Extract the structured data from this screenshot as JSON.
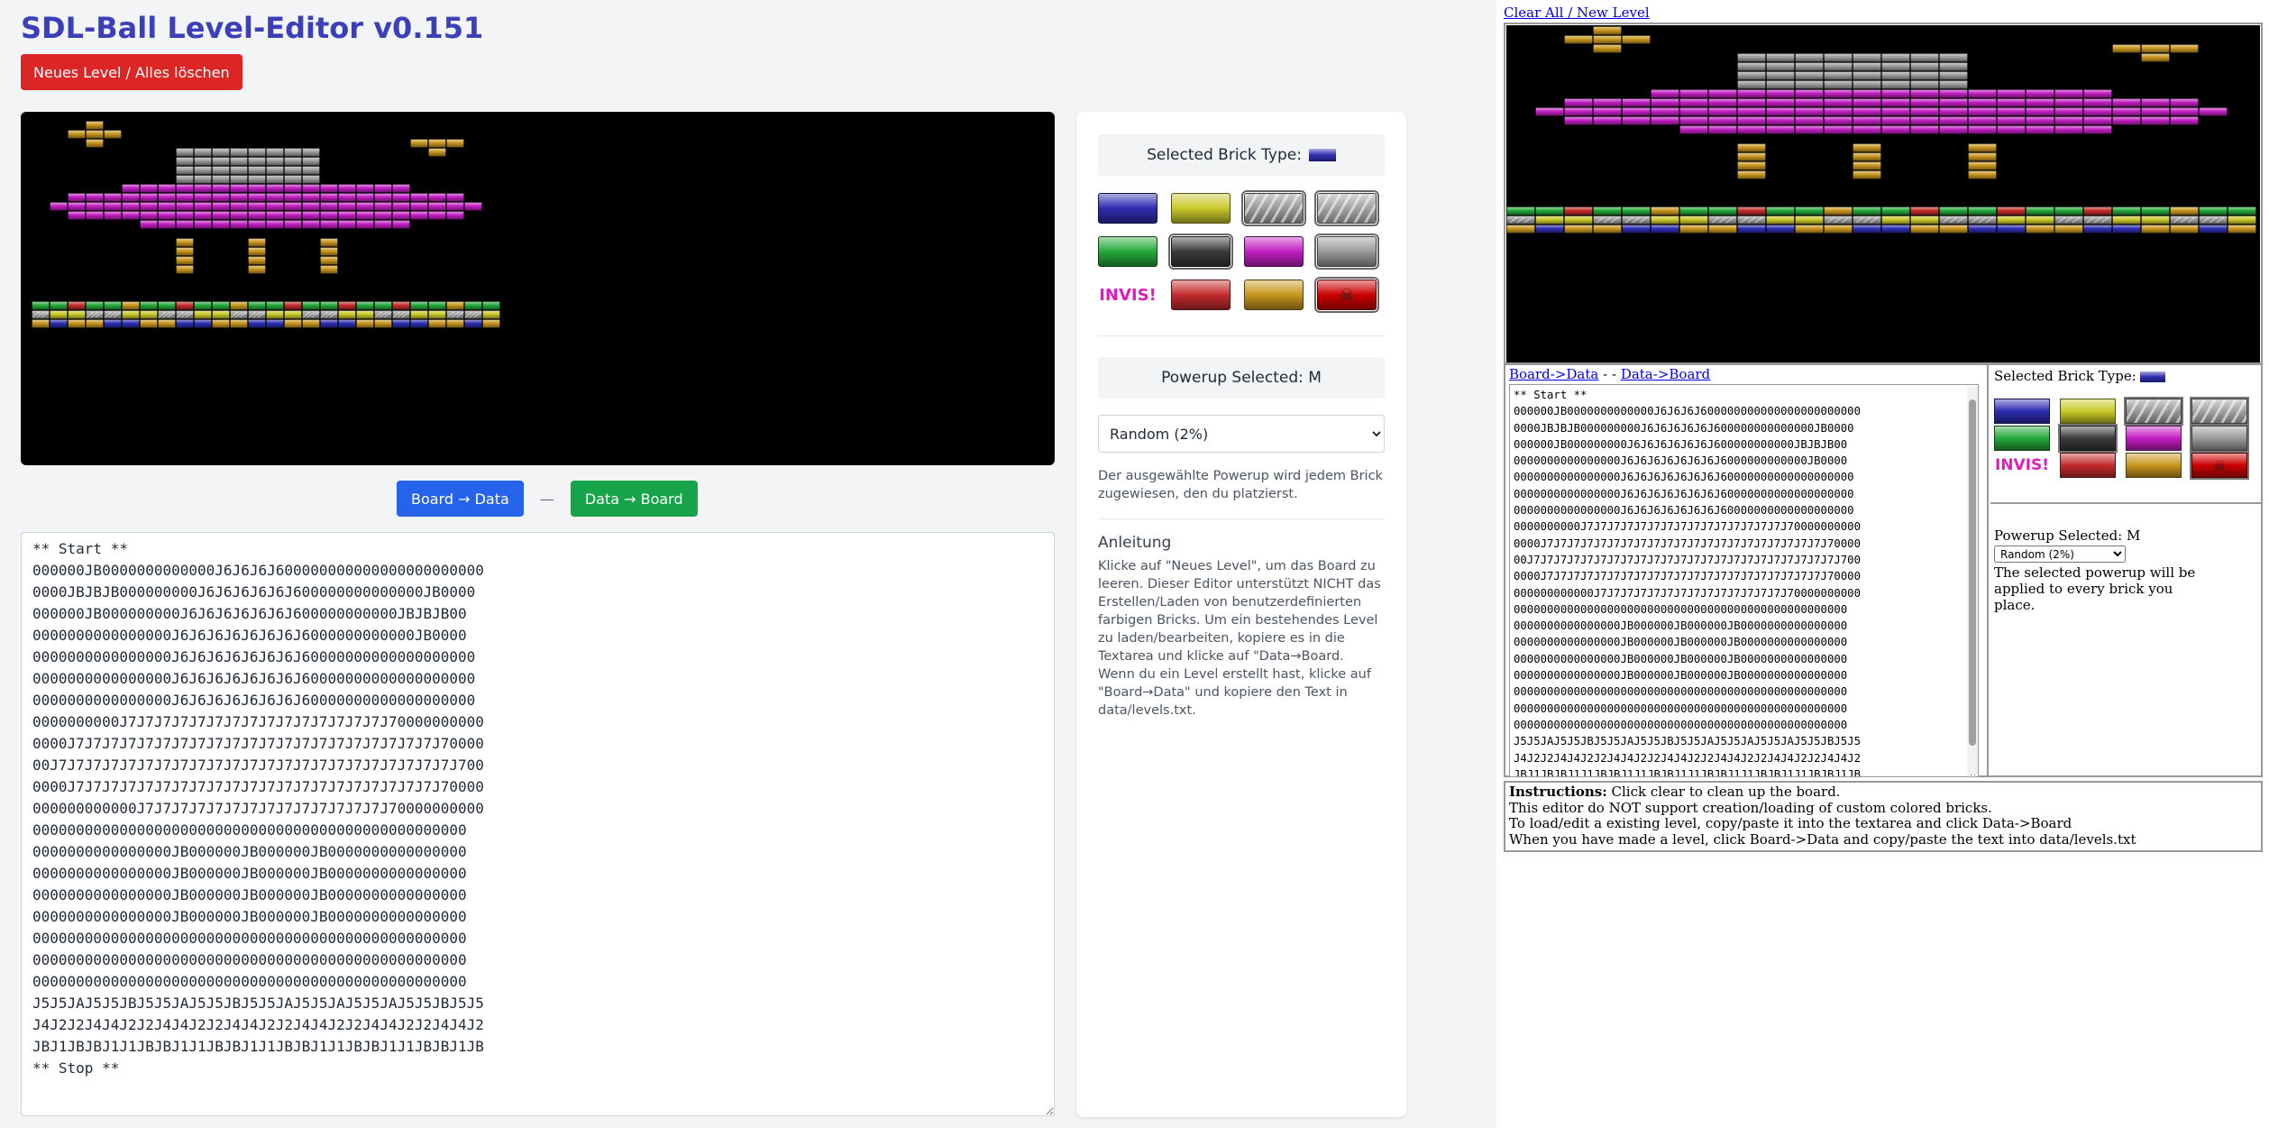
{
  "app": {
    "title": "SDL-Ball Level-Editor v0.151"
  },
  "actions": {
    "new_level": "Neues Level / Alles löschen",
    "board_to_data": "Board → Data",
    "separator": "—",
    "data_to_board": "Data → Board"
  },
  "side": {
    "selected_brick_label": "Selected Brick Type:",
    "selected_brick_color": "#2d2db0",
    "brick_palette": [
      {
        "id": "blue",
        "color": "#2d2db0"
      },
      {
        "id": "yellow",
        "color": "#c9c92a"
      },
      {
        "id": "glass",
        "color": "#8a8a8a"
      },
      {
        "id": "cement",
        "color": "#9a9a9a"
      },
      {
        "id": "green",
        "color": "#25a83a"
      },
      {
        "id": "black",
        "color": "#3a3a3a"
      },
      {
        "id": "purple",
        "color": "#c21ec2"
      },
      {
        "id": "grey",
        "color": "#9a9a9a"
      },
      {
        "id": "invisible",
        "label": "INVIS!"
      },
      {
        "id": "red",
        "color": "#c42b2b"
      },
      {
        "id": "gold",
        "color": "#c8961e"
      },
      {
        "id": "explosive",
        "color": "#cc0000"
      }
    ],
    "powerup_selected_label": "Powerup Selected: M",
    "powerup_option": "Random (2%)",
    "powerup_note": "Der ausgewählte Powerup wird jedem Brick zugewiesen, den du platzierst.",
    "instructions_title": "Anleitung",
    "instructions_body": "Klicke auf \"Neues Level\", um das Board zu leeren. Dieser Editor unterstützt NICHT das Erstellen/Laden von benutzerdefinierten farbigen Bricks. Um ein bestehendes Level zu laden/bearbeiten, kopiere es in die Textarea und klicke auf \"Data→Board. Wenn du ein Level erstellt hast, klicke auf \"Board→Data\" und kopiere den Text in data/levels.txt."
  },
  "level_text": "** Start **\n000000JB0000000000000J6J6J6J600000000000000000000000\n0000JBJBJB000000000J6J6J6J6J6J600000000000000JB0000\n000000JB000000000J6J6J6J6J6J6J600000000000JBJBJB00\n0000000000000000J6J6J6J6J6J6J6J6000000000000JB0000\n0000000000000000J6J6J6J6J6J6J6J60000000000000000000\n0000000000000000J6J6J6J6J6J6J6J60000000000000000000\n0000000000000000J6J6J6J6J6J6J6J60000000000000000000\n0000000000J7J7J7J7J7J7J7J7J7J7J7J7J7J7J7J70000000000\n0000J7J7J7J7J7J7J7J7J7J7J7J7J7J7J7J7J7J7J7J7J7J70000\n00J7J7J7J7J7J7J7J7J7J7J7J7J7J7J7J7J7J7J7J7J7J7J7J700\n0000J7J7J7J7J7J7J7J7J7J7J7J7J7J7J7J7J7J7J7J7J7J70000\n000000000000J7J7J7J7J7J7J7J7J7J7J7J7J7J7J70000000000\n00000000000000000000000000000000000000000000000000\n0000000000000000JB000000JB000000JB0000000000000000\n0000000000000000JB000000JB000000JB0000000000000000\n0000000000000000JB000000JB000000JB0000000000000000\n0000000000000000JB000000JB000000JB0000000000000000\n00000000000000000000000000000000000000000000000000\n00000000000000000000000000000000000000000000000000\n00000000000000000000000000000000000000000000000000\nJ5J5JAJ5J5JBJ5J5JAJ5J5JBJ5J5JAJ5J5JAJ5J5JAJ5J5JBJ5J5\nJ4J2J2J4J4J2J2J4J4J2J2J4J4J2J2J4J4J2J2J4J4J2J2J4J4J2\nJBJ1JBJBJ1J1JBJBJ1J1JBJBJ1J1JBJBJ1J1JBJBJ1J1JBJBJ1JB\n** Stop **",
  "legacy": {
    "clear_link": "Clear All / New Level",
    "board_to_data_link": "Board->Data",
    "link_sep": " - - ",
    "data_to_board_link": "Data->Board",
    "selected_brick_label": "Selected Brick Type:",
    "powerup_selected_label": "Powerup Selected: M",
    "powerup_option": "Random (2%)",
    "powerup_note": "The selected powerup will be applied to every brick you place.",
    "instructions_title": "Instructions:",
    "instructions_1": " Click clear to clean up the board.",
    "instructions_2": "This editor do NOT support creation/loading of custom colored bricks.",
    "instructions_3": "To load/edit a existing level, copy/paste it into the textarea and click Data->Board",
    "instructions_4": "When you have made a level, click Board->Data and copy/paste the text into data/levels.txt"
  },
  "colors": {
    "title": "#3b3fb8",
    "danger": "#dc2626",
    "primary": "#2563eb",
    "success": "#16a34a",
    "brick_purple": "#c21ec2",
    "brick_grey": "#9a9a9a",
    "brick_gold": "#c8961e",
    "brick_green": "#25a83a",
    "brick_blue": "#2d2db0",
    "brick_red": "#c42b2b",
    "brick_yellow": "#c9c92a"
  }
}
